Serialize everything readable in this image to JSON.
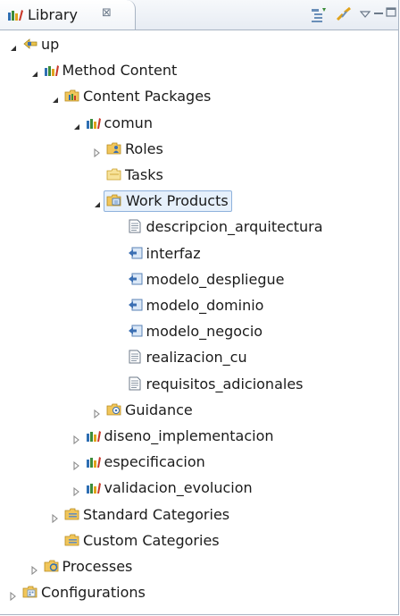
{
  "view": {
    "tab_title": "Library",
    "close_glyph": "⊠"
  },
  "tree": [
    {
      "label": "up",
      "depth": 0,
      "expanded": true,
      "icon": "plugin-icon"
    },
    {
      "label": "Method Content",
      "depth": 1,
      "expanded": true,
      "icon": "method-library-icon"
    },
    {
      "label": "Content Packages",
      "depth": 2,
      "expanded": true,
      "icon": "content-packages-folder-icon"
    },
    {
      "label": "comun",
      "depth": 3,
      "expanded": true,
      "icon": "content-package-icon"
    },
    {
      "label": "Roles",
      "depth": 4,
      "expanded": false,
      "icon": "roles-folder-icon"
    },
    {
      "label": "Tasks",
      "depth": 4,
      "expanded": null,
      "icon": "tasks-folder-icon"
    },
    {
      "label": "Work Products",
      "depth": 4,
      "expanded": true,
      "icon": "work-products-folder-icon",
      "selected": true
    },
    {
      "label": "descripcion_arquitectura",
      "depth": 5,
      "expanded": null,
      "icon": "artifact-document-icon"
    },
    {
      "label": "interfaz",
      "depth": 5,
      "expanded": null,
      "icon": "artifact-model-icon"
    },
    {
      "label": "modelo_despliegue",
      "depth": 5,
      "expanded": null,
      "icon": "artifact-model-icon"
    },
    {
      "label": "modelo_dominio",
      "depth": 5,
      "expanded": null,
      "icon": "artifact-model-icon"
    },
    {
      "label": "modelo_negocio",
      "depth": 5,
      "expanded": null,
      "icon": "artifact-model-icon"
    },
    {
      "label": "realizacion_cu",
      "depth": 5,
      "expanded": null,
      "icon": "artifact-document-icon"
    },
    {
      "label": "requisitos_adicionales",
      "depth": 5,
      "expanded": null,
      "icon": "artifact-document-icon"
    },
    {
      "label": "Guidance",
      "depth": 4,
      "expanded": false,
      "icon": "guidance-folder-icon"
    },
    {
      "label": "diseno_implementacion",
      "depth": 3,
      "expanded": false,
      "icon": "content-package-icon"
    },
    {
      "label": "especificacion",
      "depth": 3,
      "expanded": false,
      "icon": "content-package-icon"
    },
    {
      "label": "validacion_evolucion",
      "depth": 3,
      "expanded": false,
      "icon": "content-package-icon"
    },
    {
      "label": "Standard Categories",
      "depth": 2,
      "expanded": false,
      "icon": "categories-folder-icon"
    },
    {
      "label": "Custom Categories",
      "depth": 2,
      "expanded": null,
      "icon": "categories-folder-icon"
    },
    {
      "label": "Processes",
      "depth": 1,
      "expanded": false,
      "icon": "processes-folder-icon"
    },
    {
      "label": "Configurations",
      "depth": 0,
      "expanded": false,
      "icon": "configurations-folder-icon"
    }
  ],
  "colors": {
    "selection_bg": "#e6f0fb",
    "selection_border": "#8fb2dc",
    "tab_border": "#a8b4c3"
  }
}
